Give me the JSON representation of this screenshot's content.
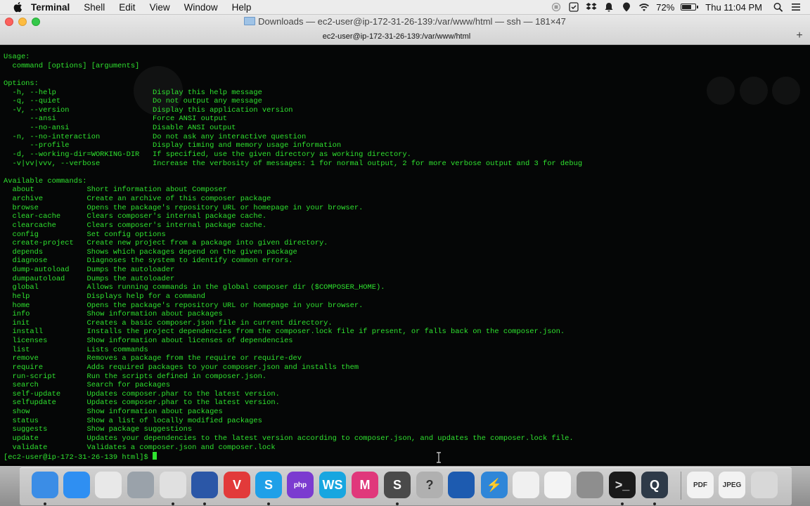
{
  "menubar": {
    "app_name": "Terminal",
    "items": [
      "Shell",
      "Edit",
      "View",
      "Window",
      "Help"
    ],
    "battery": "72%",
    "battery_level": 0.72,
    "clock": "Thu 11:04 PM"
  },
  "window": {
    "title": "Downloads — ec2-user@ip-172-31-26-139:/var/www/html — ssh — 181×47",
    "tab_title": "ec2-user@ip-172-31-26-139:/var/www/html"
  },
  "terminal": {
    "lines": [
      "Usage:",
      "  command [options] [arguments]",
      "",
      "Options:",
      "  -h, --help                      Display this help message",
      "  -q, --quiet                     Do not output any message",
      "  -V, --version                   Display this application version",
      "      --ansi                      Force ANSI output",
      "      --no-ansi                   Disable ANSI output",
      "  -n, --no-interaction            Do not ask any interactive question",
      "      --profile                   Display timing and memory usage information",
      "  -d, --working-dir=WORKING-DIR   If specified, use the given directory as working directory.",
      "  -v|vv|vvv, --verbose            Increase the verbosity of messages: 1 for normal output, 2 for more verbose output and 3 for debug",
      "",
      "Available commands:",
      "  about            Short information about Composer",
      "  archive          Create an archive of this composer package",
      "  browse           Opens the package's repository URL or homepage in your browser.",
      "  clear-cache      Clears composer's internal package cache.",
      "  clearcache       Clears composer's internal package cache.",
      "  config           Set config options",
      "  create-project   Create new project from a package into given directory.",
      "  depends          Shows which packages depend on the given package",
      "  diagnose         Diagnoses the system to identify common errors.",
      "  dump-autoload    Dumps the autoloader",
      "  dumpautoload     Dumps the autoloader",
      "  global           Allows running commands in the global composer dir ($COMPOSER_HOME).",
      "  help             Displays help for a command",
      "  home             Opens the package's repository URL or homepage in your browser.",
      "  info             Show information about packages",
      "  init             Creates a basic composer.json file in current directory.",
      "  install          Installs the project dependencies from the composer.lock file if present, or falls back on the composer.json.",
      "  licenses         Show information about licenses of dependencies",
      "  list             Lists commands",
      "  remove           Removes a package from the require or require-dev",
      "  require          Adds required packages to your composer.json and installs them",
      "  run-script       Run the scripts defined in composer.json.",
      "  search           Search for packages",
      "  self-update      Updates composer.phar to the latest version.",
      "  selfupdate       Updates composer.phar to the latest version.",
      "  show             Show information about packages",
      "  status           Show a list of locally modified packages",
      "  suggests         Show package suggestions",
      "  update           Updates your dependencies to the latest version according to composer.json, and updates the composer.lock file.",
      "  validate         Validates a composer.json and composer.lock",
      "[ec2-user@ip-172-31-26-139 html]$ "
    ]
  },
  "dock": {
    "apps": [
      {
        "name": "finder-icon",
        "color": "#3b8de6",
        "glyph": "",
        "running": true
      },
      {
        "name": "safari-icon",
        "color": "#2f8ff2",
        "glyph": "",
        "running": false
      },
      {
        "name": "launchpad-icon",
        "color": "#e8e8e8",
        "glyph": "",
        "running": false
      },
      {
        "name": "rocket-icon",
        "color": "#9aa2aa",
        "glyph": "",
        "running": false
      },
      {
        "name": "chrome-icon",
        "color": "#e0e0e0",
        "glyph": "",
        "running": true
      },
      {
        "name": "firefox-icon",
        "color": "#2b57a7",
        "glyph": "",
        "running": true
      },
      {
        "name": "vivaldi-icon",
        "color": "#e23a3a",
        "glyph": "V",
        "running": false
      },
      {
        "name": "skype-icon",
        "color": "#1fa0e8",
        "glyph": "S",
        "running": true
      },
      {
        "name": "phpstorm-icon",
        "color": "#7b3bd0",
        "glyph": "php",
        "running": false
      },
      {
        "name": "webstorm-icon",
        "color": "#18a6e0",
        "glyph": "WS",
        "running": false
      },
      {
        "name": "vs-icon",
        "color": "#e0387b",
        "glyph": "M",
        "running": false
      },
      {
        "name": "sublime-icon",
        "color": "#4a4a4a",
        "glyph": "S",
        "running": true
      },
      {
        "name": "help-icon",
        "color": "#b0b0b0",
        "glyph": "?",
        "running": false
      },
      {
        "name": "sourcetree-icon",
        "color": "#1d5bb0",
        "glyph": "",
        "running": false
      },
      {
        "name": "bolt-icon",
        "color": "#2f86d8",
        "glyph": "⚡",
        "running": false
      },
      {
        "name": "photos-icon",
        "color": "#f0f0f0",
        "glyph": "",
        "running": false
      },
      {
        "name": "popcorn-icon",
        "color": "#f4f4f4",
        "glyph": "",
        "running": false
      },
      {
        "name": "system-preferences-icon",
        "color": "#8e8e8e",
        "glyph": "",
        "running": false
      },
      {
        "name": "terminal-icon",
        "color": "#1a1a1a",
        "glyph": ">_",
        "running": true
      },
      {
        "name": "quicktime-icon",
        "color": "#2e3a48",
        "glyph": "Q",
        "running": true
      },
      {
        "name": "pdf-document-icon",
        "color": "#f2f2f2",
        "glyph": "PDF",
        "running": false
      },
      {
        "name": "jpeg-document-icon",
        "color": "#f2f2f2",
        "glyph": "JPEG",
        "running": false
      },
      {
        "name": "trash-icon",
        "color": "#d8d8d8",
        "glyph": "",
        "running": false
      }
    ]
  }
}
